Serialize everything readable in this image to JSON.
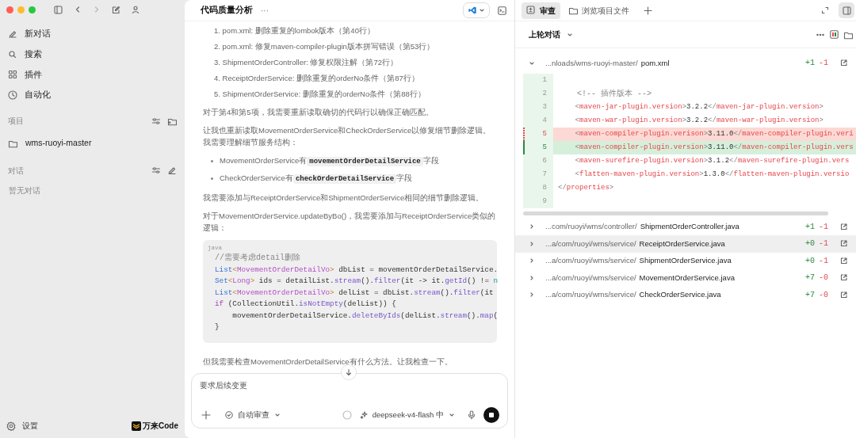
{
  "sidebar": {
    "nav": [
      {
        "label": "新对话"
      },
      {
        "label": "搜索"
      },
      {
        "label": "插件"
      },
      {
        "label": "自动化"
      }
    ],
    "projects": {
      "title": "项目",
      "items": [
        {
          "label": "wms-ruoyi-master"
        }
      ]
    },
    "chats": {
      "title": "对话",
      "empty": "暂无对话"
    },
    "settings": "设置",
    "brand": "万来Code"
  },
  "chat": {
    "title": "代码质量分析",
    "menu": "···",
    "fixes": [
      "1. pom.xml: 删除重复的lombok版本（第40行）",
      "2. pom.xml: 修复maven-compiler-plugin版本拼写错误（第53行）",
      "3. ShipmentOrderController: 修复权限注解（第72行）",
      "4. ReceiptOrderService: 删除重复的orderNo条件（第87行）",
      "5. ShipmentOrderService: 删除重复的orderNo条件（第88行）"
    ],
    "para1": "对于第4和第5项，我需要重新读取确切的代码行以确保正确匹配。",
    "para2": "让我也重新读取MovementOrderService和CheckOrderService以修复细节删除逻辑。我需要理解细节服务结构：",
    "bullets": [
      [
        {
          "text": "MovementOrderService有"
        },
        {
          "code": "movementOrderDetailService"
        },
        {
          "text": "字段"
        }
      ],
      [
        {
          "text": "CheckOrderService有"
        },
        {
          "code": "checkOrderDetailService"
        },
        {
          "text": "字段"
        }
      ]
    ],
    "para3": "我需要添加与ReceiptOrderService和ShipmentOrderService相同的细节删除逻辑。",
    "para4": "对于MovementOrderService.updateByBo()，我需要添加与ReceiptOrderService类似的逻辑：",
    "code": {
      "language": "java",
      "lines": [
        [
          {
            "text": "//需要考虑detail删除",
            "kind": "comment"
          }
        ],
        [
          {
            "text": "List",
            "kind": "type"
          },
          {
            "text": "<",
            "kind": "punct"
          },
          {
            "text": "MovementOrderDetailVo",
            "kind": "generic"
          },
          {
            "text": ">",
            "kind": "punct"
          },
          {
            "text": " dbList = movementOrderDetailService.",
            "kind": "plain"
          }
        ],
        [
          {
            "text": "Set",
            "kind": "type"
          },
          {
            "text": "<",
            "kind": "punct"
          },
          {
            "text": "Long",
            "kind": "generic"
          },
          {
            "text": ">",
            "kind": "punct"
          },
          {
            "text": " ids = detailList.",
            "kind": "plain"
          },
          {
            "text": "stream",
            "kind": "method"
          },
          {
            "text": "().",
            "kind": "plain"
          },
          {
            "text": "filter",
            "kind": "method"
          },
          {
            "text": "(it -> it.",
            "kind": "plain"
          },
          {
            "text": "getId",
            "kind": "method"
          },
          {
            "text": "() != ",
            "kind": "plain"
          },
          {
            "text": "n",
            "kind": "literal"
          }
        ],
        [
          {
            "text": "List",
            "kind": "type"
          },
          {
            "text": "<",
            "kind": "punct"
          },
          {
            "text": "MovementOrderDetailVo",
            "kind": "generic"
          },
          {
            "text": ">",
            "kind": "punct"
          },
          {
            "text": " delList = dbList.",
            "kind": "plain"
          },
          {
            "text": "stream",
            "kind": "method"
          },
          {
            "text": "().",
            "kind": "plain"
          },
          {
            "text": "filter",
            "kind": "method"
          },
          {
            "text": "(it",
            "kind": "plain"
          }
        ],
        [
          {
            "text": "if",
            "kind": "keyword"
          },
          {
            "text": " (CollectionUtil.",
            "kind": "plain"
          },
          {
            "text": "isNotEmpty",
            "kind": "method"
          },
          {
            "text": "(delList)) {",
            "kind": "plain"
          }
        ],
        [
          {
            "text": "    movementOrderDetailService.",
            "kind": "plain"
          },
          {
            "text": "deleteByIds",
            "kind": "method"
          },
          {
            "text": "(delList.",
            "kind": "plain"
          },
          {
            "text": "stream",
            "kind": "method"
          },
          {
            "text": "().",
            "kind": "plain"
          },
          {
            "text": "map",
            "kind": "method"
          },
          {
            "text": "(",
            "kind": "plain"
          }
        ],
        [
          {
            "text": "}",
            "kind": "plain"
          }
        ]
      ]
    },
    "para5": "但我需要检查MovementOrderDetailService有什么方法。让我检查一下。",
    "composer": {
      "placeholder": "要求后续变更",
      "review_mode": "自动审查",
      "model": "deepseek-v4-flash 中"
    }
  },
  "review": {
    "tabs": [
      {
        "label": "审查",
        "selected": true
      },
      {
        "label": "浏览项目文件",
        "selected": false
      }
    ],
    "scope": "上轮对话",
    "files": [
      {
        "path": "...nloads/wms-ruoyi-master/",
        "name": "pom.xml",
        "added": "+1",
        "removed": "-1",
        "expanded": true,
        "selected": false,
        "lines": [
          {
            "number": "1",
            "kind": "context"
          },
          {
            "number": "2",
            "kind": "context",
            "tokens": [
              {
                "text": "    <!-- 插件版本 -->",
                "kind": "comment"
              }
            ]
          },
          {
            "number": "3",
            "kind": "context",
            "tokens": [
              {
                "text": "    <",
                "kind": "punct"
              },
              {
                "text": "maven-jar-plugin.version",
                "kind": "tag"
              },
              {
                "text": ">",
                "kind": "punct"
              },
              {
                "text": "3.2.2",
                "kind": "text"
              },
              {
                "text": "</",
                "kind": "punct"
              },
              {
                "text": "maven-jar-plugin.version",
                "kind": "tag"
              },
              {
                "text": ">",
                "kind": "punct"
              }
            ]
          },
          {
            "number": "4",
            "kind": "context",
            "tokens": [
              {
                "text": "    <",
                "kind": "punct"
              },
              {
                "text": "maven-war-plugin.version",
                "kind": "tag"
              },
              {
                "text": ">",
                "kind": "punct"
              },
              {
                "text": "3.2.2",
                "kind": "text"
              },
              {
                "text": "</",
                "kind": "punct"
              },
              {
                "text": "maven-war-plugin.version",
                "kind": "tag"
              },
              {
                "text": ">",
                "kind": "punct"
              }
            ]
          },
          {
            "number": "5",
            "kind": "removed",
            "tokens": [
              {
                "text": "    <",
                "kind": "punct"
              },
              {
                "text": "maven-compiler-plugin.verison",
                "kind": "tag"
              },
              {
                "text": ">",
                "kind": "punct"
              },
              {
                "text": "3.11.0",
                "kind": "text"
              },
              {
                "text": "</",
                "kind": "punct"
              },
              {
                "text": "maven-compiler-plugin.veri",
                "kind": "tag"
              }
            ]
          },
          {
            "number": "5",
            "kind": "added",
            "tokens": [
              {
                "text": "    <",
                "kind": "punct"
              },
              {
                "text": "maven-compiler-plugin.version",
                "kind": "tag"
              },
              {
                "text": ">",
                "kind": "punct"
              },
              {
                "text": "3.11.0",
                "kind": "text"
              },
              {
                "text": "</",
                "kind": "punct"
              },
              {
                "text": "maven-compiler-plugin.vers",
                "kind": "tag"
              }
            ]
          },
          {
            "number": "6",
            "kind": "context",
            "tokens": [
              {
                "text": "    <",
                "kind": "punct"
              },
              {
                "text": "maven-surefire-plugin.version",
                "kind": "tag"
              },
              {
                "text": ">",
                "kind": "punct"
              },
              {
                "text": "3.1.2",
                "kind": "text"
              },
              {
                "text": "</",
                "kind": "punct"
              },
              {
                "text": "maven-surefire-plugin.vers",
                "kind": "tag"
              }
            ]
          },
          {
            "number": "7",
            "kind": "context",
            "tokens": [
              {
                "text": "    <",
                "kind": "punct"
              },
              {
                "text": "flatten-maven-plugin.version",
                "kind": "tag"
              },
              {
                "text": ">",
                "kind": "punct"
              },
              {
                "text": "1.3.0",
                "kind": "text"
              },
              {
                "text": "</",
                "kind": "punct"
              },
              {
                "text": "flatten-maven-plugin.versio",
                "kind": "tag"
              }
            ]
          },
          {
            "number": "8",
            "kind": "context",
            "tokens": [
              {
                "text": "</",
                "kind": "punct"
              },
              {
                "text": "properties",
                "kind": "tag"
              },
              {
                "text": ">",
                "kind": "punct"
              }
            ]
          },
          {
            "number": "9",
            "kind": "context"
          }
        ]
      },
      {
        "path": "...com/ruoyi/wms/controller/",
        "name": "ShipmentOrderController.java",
        "added": "+1",
        "removed": "-1",
        "expanded": false,
        "selected": false
      },
      {
        "path": "...a/com/ruoyi/wms/service/",
        "name": "ReceiptOrderService.java",
        "added": "+0",
        "removed": "-1",
        "expanded": false,
        "selected": true
      },
      {
        "path": "...a/com/ruoyi/wms/service/",
        "name": "ShipmentOrderService.java",
        "added": "+0",
        "removed": "-1",
        "expanded": false,
        "selected": false
      },
      {
        "path": "...a/com/ruoyi/wms/service/",
        "name": "MovementOrderService.java",
        "added": "+7",
        "removed": "-0",
        "expanded": false,
        "selected": false
      },
      {
        "path": "...a/com/ruoyi/wms/service/",
        "name": "CheckOrderService.java",
        "added": "+7",
        "removed": "-0",
        "expanded": false,
        "selected": false
      }
    ]
  }
}
